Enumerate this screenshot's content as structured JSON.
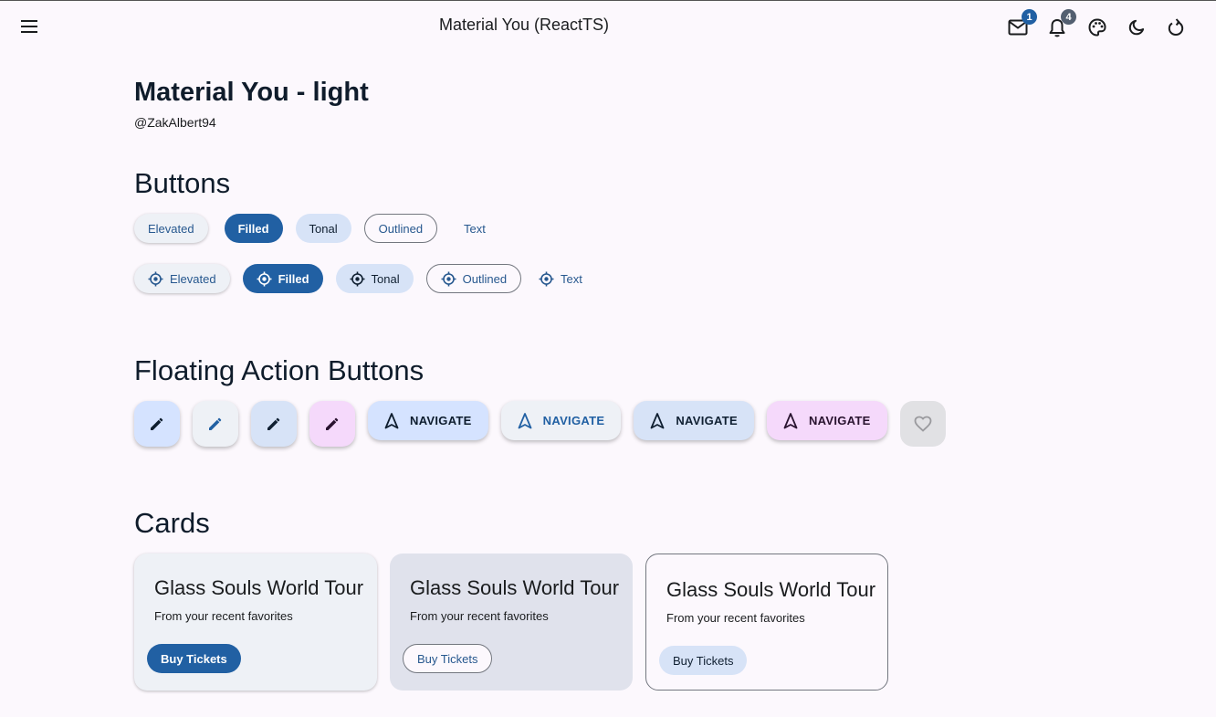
{
  "appbar": {
    "title": "Material You (ReactTS)",
    "mail_badge": "1",
    "notifications_badge": "4",
    "badge_colors": {
      "mail": "#2160a3",
      "notifications": "#535f70"
    }
  },
  "header": {
    "title": "Material You - light",
    "subtitle": "@ZakAlbert94"
  },
  "buttons_section": {
    "title": "Buttons",
    "row1": [
      "Elevated",
      "Filled",
      "Tonal",
      "Outlined",
      "Text"
    ],
    "row2": [
      "Elevated",
      "Filled",
      "Tonal",
      "Outlined",
      "Text"
    ]
  },
  "fab_section": {
    "title": "Floating Action Buttons",
    "fabs": [
      {
        "icon": "pencil-icon",
        "variant": "primary"
      },
      {
        "icon": "pencil-icon",
        "variant": "surface"
      },
      {
        "icon": "pencil-icon",
        "variant": "secondary"
      },
      {
        "icon": "pencil-icon",
        "variant": "tertiary"
      }
    ],
    "extended": [
      "NAVIGATE",
      "NAVIGATE",
      "NAVIGATE",
      "NAVIGATE"
    ],
    "disabled_icon": "heart-icon"
  },
  "cards_section": {
    "title": "Cards",
    "cards": [
      {
        "title": "Glass Souls World Tour",
        "subtitle": "From your recent favorites",
        "button": "Buy Tickets"
      },
      {
        "title": "Glass Souls World Tour",
        "subtitle": "From your recent favorites",
        "button": "Buy Tickets"
      },
      {
        "title": "Glass Souls World Tour",
        "subtitle": "From your recent favorites",
        "button": "Buy Tickets"
      }
    ]
  },
  "colors": {
    "primary": "#2160a3",
    "background": "#fcf8fd",
    "primary_container": "#d5e3ff",
    "tertiary_container": "#f5d9fb"
  }
}
